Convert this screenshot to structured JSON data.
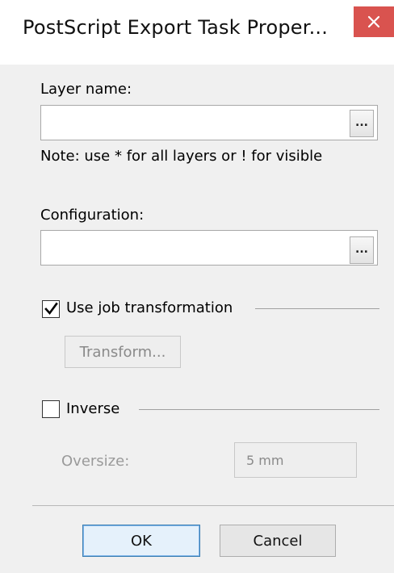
{
  "window": {
    "title": "PostScript Export Task Proper...",
    "close_symbol": "close-icon"
  },
  "layer": {
    "label": "Layer name:",
    "value": "",
    "browse_label": "...",
    "note": "Note: use * for all layers or ! for visible"
  },
  "configuration": {
    "label": "Configuration:",
    "value": "",
    "browse_label": "..."
  },
  "job_transformation": {
    "label": "Use job transformation",
    "checked": true,
    "transform_button": "Transform..."
  },
  "inverse": {
    "label": "Inverse",
    "checked": false,
    "oversize_label": "Oversize:",
    "oversize_value": "5 mm"
  },
  "buttons": {
    "ok": "OK",
    "cancel": "Cancel"
  },
  "colors": {
    "close_button": "#d9534f",
    "default_button_border": "#3c7fb1",
    "window_background": "#f0f0f0"
  }
}
